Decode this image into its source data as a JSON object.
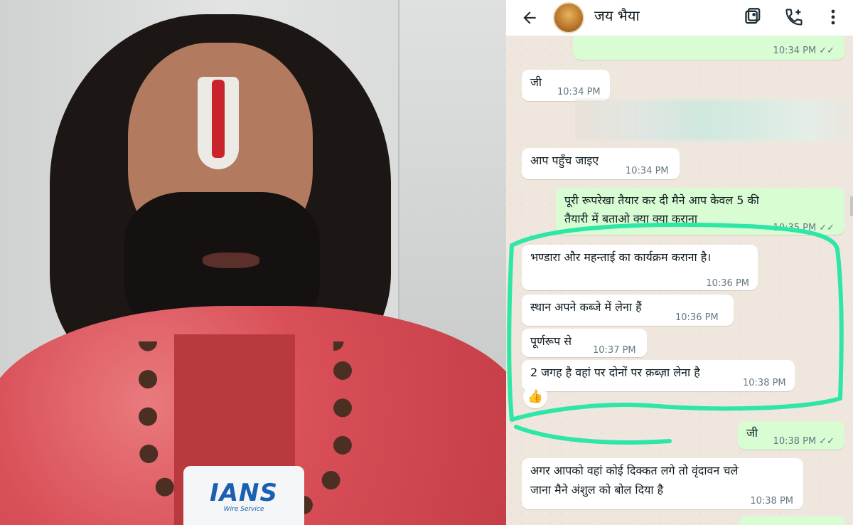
{
  "photo": {
    "mic_logo": "IANS",
    "mic_sub": "Wire Service"
  },
  "chat": {
    "contact_name": "जय भैया",
    "icons": {
      "back": "arrow-left-icon",
      "video": "video-call-icon",
      "call": "add-call-icon",
      "menu": "more-vert-icon"
    },
    "messages": [
      {
        "dir": "out",
        "text": "",
        "time": "10:34 PM",
        "ticks": "✓✓"
      },
      {
        "dir": "in",
        "text": "जी",
        "time": "10:34 PM"
      },
      {
        "dir": "in",
        "text": "आप पहुँच जाइए",
        "time": "10:34 PM"
      },
      {
        "dir": "out",
        "text_line1": "पूरी रूपरेखा तैयार कर दी मैने आप केवल 5 की",
        "text_line2": "तैयारी में बताओ क्या क्या कराना",
        "time": "10:35 PM",
        "ticks": "✓✓"
      },
      {
        "dir": "in",
        "text": "भण्डारा और महन्ताई का कार्यक्रम कराना है।",
        "time": "10:36 PM"
      },
      {
        "dir": "in",
        "text": "स्थान अपने कब्जे में लेना हैं",
        "time": "10:36 PM"
      },
      {
        "dir": "in",
        "text": "पूर्णरूप से",
        "time": "10:37 PM"
      },
      {
        "dir": "in",
        "text": "2 जगह है वहां पर दोनों पर क़ब्ज़ा लेना है",
        "time": "10:38 PM",
        "reaction": "👍"
      },
      {
        "dir": "out",
        "text": "जी",
        "time": "10:38 PM",
        "ticks": "✓✓"
      },
      {
        "dir": "in",
        "text_line1": "अगर आपको वहां कोई दिक्कत लगे तो वृंदावन चले",
        "text_line2": "जाना मैने अंशुल को बोल दिया है",
        "time": "10:38 PM"
      }
    ]
  },
  "colors": {
    "incoming": "#ffffff",
    "outgoing": "#d9fdd3",
    "chat_bg": "#efe7dd",
    "highlight": "#2ee6a6",
    "mic_logo": "#1b5fb0"
  }
}
